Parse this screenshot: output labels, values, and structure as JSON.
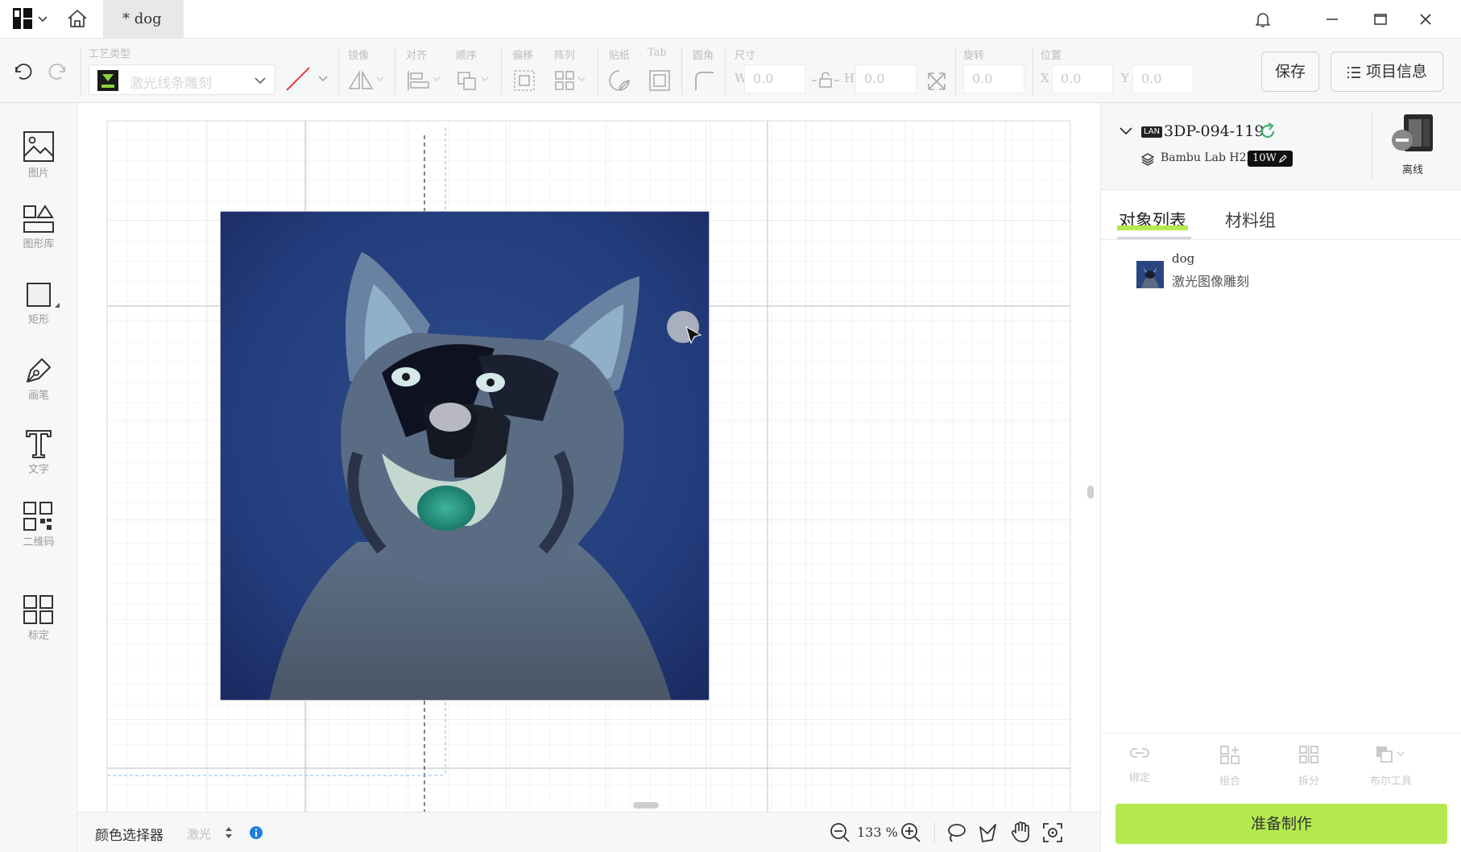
{
  "titlebar": {
    "tab_label": "* dog"
  },
  "toolbar": {
    "process_type_label": "工艺类型",
    "process_type_value": "激光线条雕刻",
    "mirror_label": "镜像",
    "align_label": "对齐",
    "order_label": "顺序",
    "offset_label": "偏移",
    "array_label": "阵列",
    "sticker_label": "贴纸",
    "tab_label": "Tab",
    "corner_label": "圆角",
    "size_label": "尺寸",
    "w_prefix": "W",
    "w_value": "0.0",
    "h_prefix": "H",
    "h_value": "0.0",
    "rotate_label": "旋转",
    "rotate_value": "0.0",
    "position_label": "位置",
    "x_prefix": "X",
    "x_value": "0.0",
    "y_prefix": "Y",
    "y_value": "0.0",
    "save_label": "保存",
    "project_info_label": "项目信息"
  },
  "left_tools": [
    {
      "label": "图片"
    },
    {
      "label": "图形库"
    },
    {
      "label": "矩形"
    },
    {
      "label": "画笔"
    },
    {
      "label": "文字"
    },
    {
      "label": "二维码"
    },
    {
      "label": "标定"
    }
  ],
  "status": {
    "color_picker_label": "颜色选择器",
    "mode_value": "激光",
    "zoom_value": "133 %"
  },
  "device": {
    "name": "3DP-094-119",
    "conn_badge": "LAN",
    "model": "Bambu Lab H2D",
    "power": "10W",
    "state_label": "离线"
  },
  "panel_tabs": [
    {
      "label": "对象列表"
    },
    {
      "label": "材料组"
    }
  ],
  "objects": [
    {
      "name": "dog",
      "process": "激光图像雕刻"
    }
  ],
  "actions": [
    {
      "label": "绑定"
    },
    {
      "label": "组合"
    },
    {
      "label": "拆分"
    },
    {
      "label": "布尔工具"
    }
  ],
  "prepare_label": "准备制作",
  "colors": {
    "accent_green": "#b4ea4e",
    "refresh_green": "#3cb371",
    "info_blue": "#1e7fe0"
  }
}
